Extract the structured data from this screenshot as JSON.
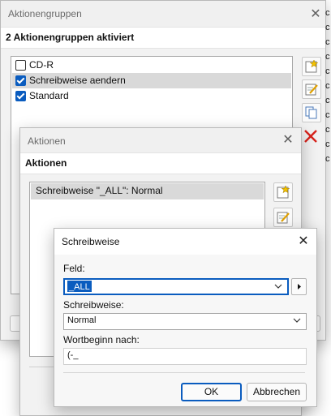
{
  "bg_window": {
    "title": "Aktionengruppen",
    "header": "2 Aktionengruppen aktiviert",
    "groups": [
      {
        "label": "CD-R",
        "checked": false
      },
      {
        "label": "Schreibweise aendern",
        "checked": true
      },
      {
        "label": "Standard",
        "checked": true
      }
    ],
    "tools": [
      {
        "name": "new-group-button",
        "icon": "star-new-icon"
      },
      {
        "name": "edit-group-button",
        "icon": "edit-icon"
      },
      {
        "name": "copy-group-button",
        "icon": "copy-icon"
      },
      {
        "name": "delete-group-button",
        "icon": "delete-x-icon"
      }
    ]
  },
  "mid_window": {
    "title": "Aktionen",
    "header": "Aktionen",
    "actions": [
      "Schreibweise \"_ALL\": Normal"
    ]
  },
  "dialog": {
    "title": "Schreibweise",
    "feld_label": "Feld:",
    "feld_value": "_ALL",
    "schreibweise_label": "Schreibweise:",
    "schreibweise_value": "Normal",
    "wortbeginn_label": "Wortbeginn nach:",
    "wortbeginn_value": "(-_",
    "ok_label": "OK",
    "cancel_label": "Abbrechen"
  },
  "colors": {
    "accent": "#0a5cbf",
    "selection": "#cfe0f5",
    "list_selected_gray": "#d9d9d9",
    "delete_red": "#d8231c"
  }
}
